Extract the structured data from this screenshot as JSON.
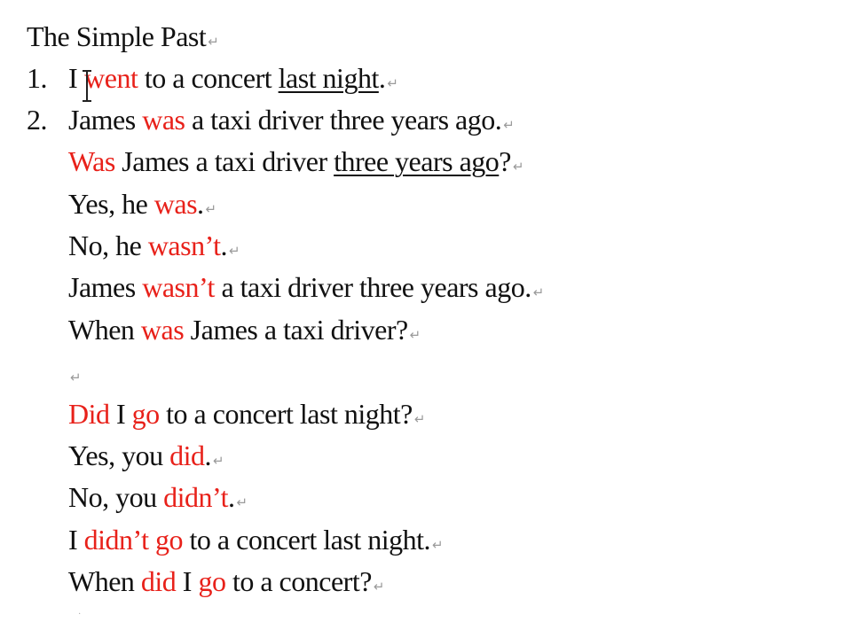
{
  "document": {
    "title": "The Simple Past",
    "paragraph_mark": "↵",
    "item1": {
      "number": "1.",
      "t1": "I",
      "t2": "went",
      "t3": " to a concert ",
      "t4": "last night",
      "t5": "."
    },
    "item2": {
      "number": "2.",
      "t1": "James ",
      "t2": "was",
      "t3": " a taxi driver three years ago."
    },
    "q1": {
      "t1": "Was",
      "t2": " James a taxi driver ",
      "t3": "three years ago",
      "t4": "?"
    },
    "a1": {
      "t1": "Yes, he ",
      "t2": "was",
      "t3": "."
    },
    "a2": {
      "t1": "No, he ",
      "t2": "wasn’t",
      "t3": "."
    },
    "neg1": {
      "t1": "James ",
      "t2": "wasn’t",
      "t3": " a taxi driver three years ago."
    },
    "wh1": {
      "t1": "When ",
      "t2": "was",
      "t3": " James a taxi driver?"
    },
    "q2": {
      "t1": "Did",
      "t2": " I ",
      "t3": "go",
      "t4": " to a concert last night?"
    },
    "a3": {
      "t1": "Yes, you ",
      "t2": "did",
      "t3": "."
    },
    "a4": {
      "t1": "No, you ",
      "t2": "didn’t",
      "t3": "."
    },
    "neg2": {
      "t1": "I ",
      "t2": "didn’t",
      "t3": " ",
      "t4": "go",
      "t5": " to a concert last night."
    },
    "wh2": {
      "t1": "When ",
      "t2": "did",
      "t3": " I ",
      "t4": "go",
      "t5": " to a concert?"
    }
  },
  "colors": {
    "text": "#111111",
    "highlight_red": "#e8211a",
    "paragraph_mark": "#9a9a9a",
    "background": "#ffffff"
  }
}
